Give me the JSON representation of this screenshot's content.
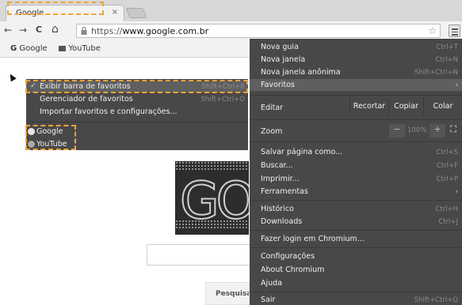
{
  "tab": {
    "title": "Google",
    "close": "×"
  },
  "toolbar": {
    "back": "←",
    "forward": "→",
    "reload": "C",
    "home": "⌂",
    "url_scheme": "https://",
    "url_host": "www.google.com.br",
    "star": "☆"
  },
  "bookmarks_bar": {
    "items": [
      {
        "icon": "google-favicon",
        "label": "Google"
      },
      {
        "icon": "youtube-favicon",
        "label": "YouTube"
      }
    ]
  },
  "page": {
    "search_button": "Pesquisa"
  },
  "menu": {
    "items": [
      {
        "label": "Nova guia",
        "shortcut": "Ctrl+T"
      },
      {
        "label": "Nova janela",
        "shortcut": "Ctrl+N"
      },
      {
        "label": "Nova janela anônima",
        "shortcut": "Shift+Ctrl+N"
      },
      {
        "label": "Favoritos",
        "arrow": "›"
      },
      {
        "label": "Editar",
        "buttons": [
          "Recortar",
          "Copiar",
          "Colar"
        ]
      },
      {
        "label": "Zoom",
        "minus": "−",
        "value": "100%",
        "plus": "+",
        "fullscreen": "⛶"
      },
      {
        "label": "Salvar página como...",
        "shortcut": "Ctrl+S"
      },
      {
        "label": "Buscar...",
        "shortcut": "Ctrl+F"
      },
      {
        "label": "Imprimir...",
        "shortcut": "Ctrl+P"
      },
      {
        "label": "Ferramentas",
        "arrow": "›"
      },
      {
        "label": "Histórico",
        "shortcut": "Ctrl+H"
      },
      {
        "label": "Downloads",
        "shortcut": "Ctrl+J"
      },
      {
        "label": "Fazer login em Chromium..."
      },
      {
        "label": "Configurações"
      },
      {
        "label": "About Chromium"
      },
      {
        "label": "Ajuda"
      },
      {
        "label": "Sair",
        "shortcut": "Shift+Ctrl+Q"
      }
    ]
  },
  "favorites_submenu": {
    "items": [
      {
        "check": "✓",
        "label": "Exibir barra de favoritos",
        "shortcut": "Shift+Ctrl+B"
      },
      {
        "label": "Gerenciador de favoritos",
        "shortcut": "Shift+Ctrl+O"
      },
      {
        "label": "Importar favoritos e configurações..."
      },
      {
        "icon": "google-favicon",
        "label": "Google"
      },
      {
        "icon": "youtube-favicon",
        "label": "YouTube"
      }
    ]
  },
  "colors": {
    "menu_bg": "#484848",
    "highlight": "#5f5f5f",
    "annotation": "#f2a33a"
  }
}
